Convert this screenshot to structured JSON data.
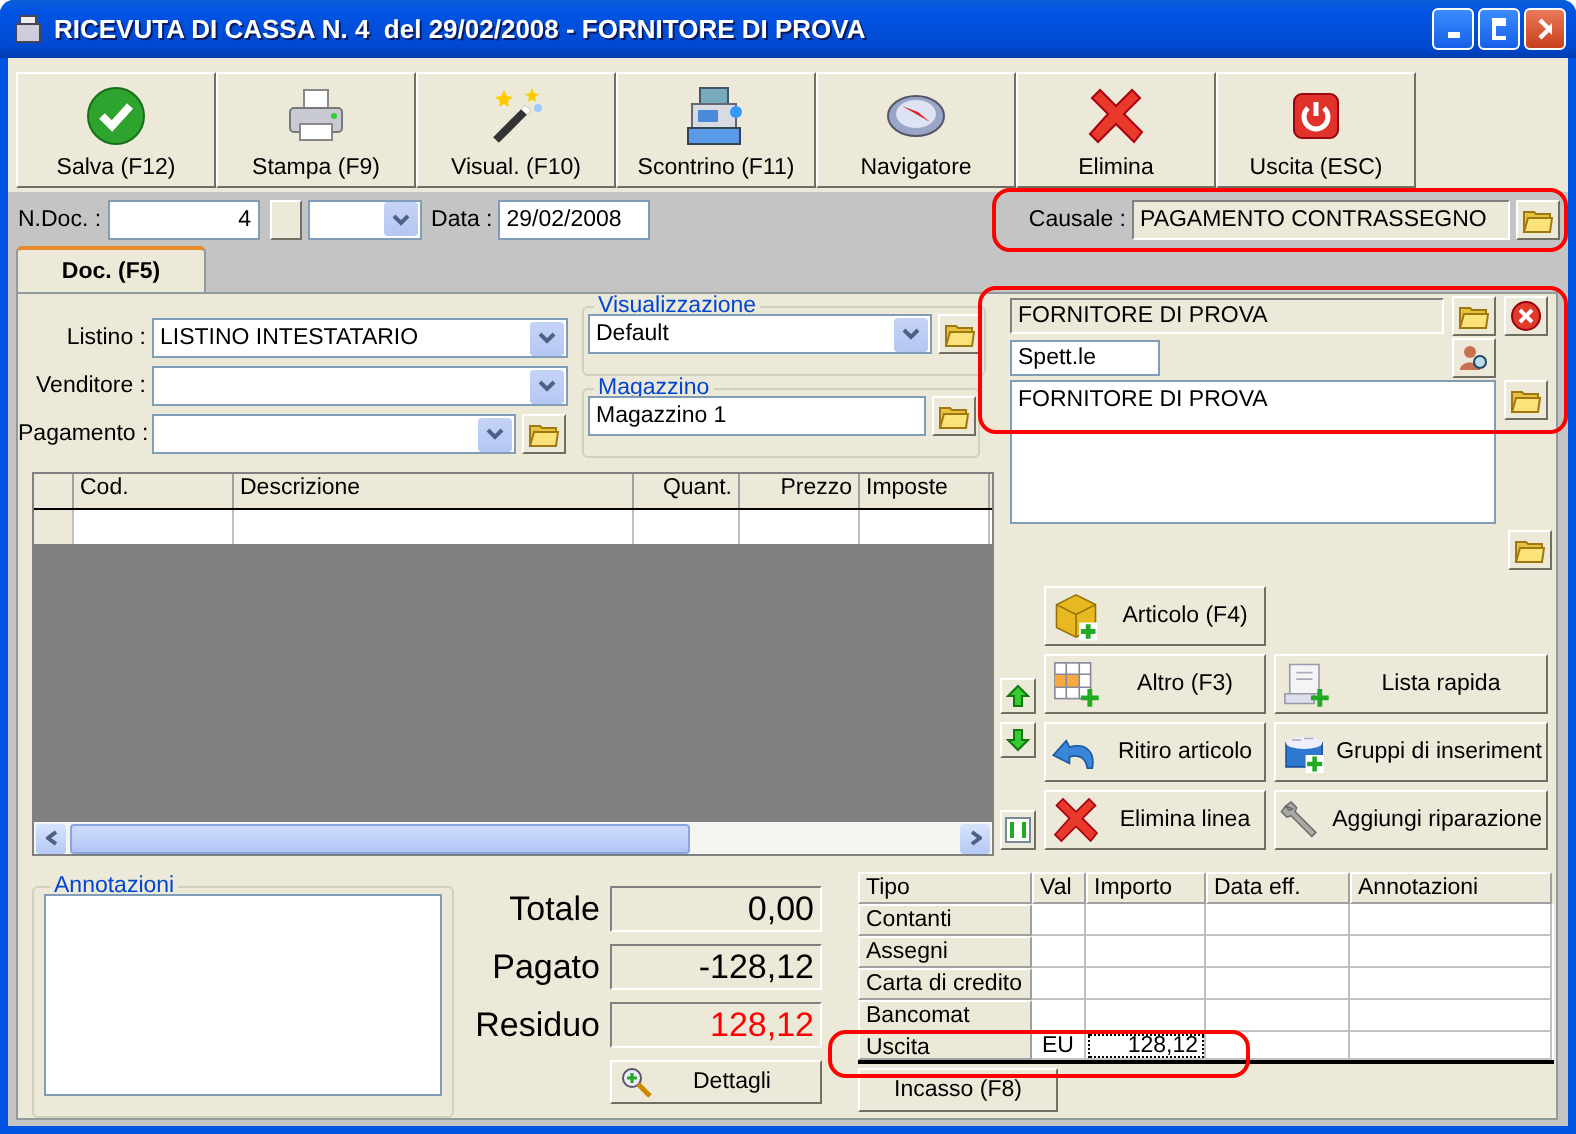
{
  "window": {
    "title": "RICEVUTA DI CASSA N. 4  del 29/02/2008 - FORNITORE DI PROVA"
  },
  "toolbar": [
    {
      "label": "Salva (F12)",
      "kind": "save"
    },
    {
      "label": "Stampa (F9)",
      "kind": "print"
    },
    {
      "label": "Visual. (F10)",
      "kind": "wand"
    },
    {
      "label": "Scontrino (F11)",
      "kind": "register"
    },
    {
      "label": "Navigatore",
      "kind": "compass"
    },
    {
      "label": "Elimina",
      "kind": "delete"
    },
    {
      "label": "Uscita (ESC)",
      "kind": "exit"
    }
  ],
  "header": {
    "ndoc_label": "N.Doc. :",
    "ndoc": "4",
    "date_label": "Data :",
    "date": "29/02/2008",
    "causale_label": "Causale :",
    "causale": "PAGAMENTO CONTRASSEGNO"
  },
  "tabs": [
    {
      "label": "Doc. (F5)",
      "selected": true
    }
  ],
  "form": {
    "fields": [
      {
        "label": "Listino :",
        "value": "LISTINO INTESTATARIO",
        "folder": false
      },
      {
        "label": "Venditore :",
        "folder": false
      },
      {
        "label": "Pagamento :",
        "folder": true
      }
    ],
    "visualizzazione": {
      "title": "Visualizzazione",
      "value": "Default"
    },
    "magazzino": {
      "title": "Magazzino",
      "value": "Magazzino 1"
    }
  },
  "supplier": {
    "name": "FORNITORE DI PROVA",
    "salutation": "Spett.le",
    "address": "FORNITORE DI PROVA"
  },
  "lines_table": {
    "columns": [
      "Cod.",
      "Descrizione",
      "Quant.",
      "Prezzo",
      "Imposte"
    ]
  },
  "actions": [
    {
      "label": "Articolo (F4)",
      "kind": "box"
    },
    {
      "label": "Altro (F3)",
      "kind": "grid"
    },
    {
      "label": "Lista rapida",
      "kind": "scroll"
    },
    {
      "label": "Ritiro articolo",
      "kind": "undo"
    },
    {
      "label": "Gruppi di inseriment",
      "kind": "bucket"
    },
    {
      "label": "Elimina linea",
      "kind": "delete"
    },
    {
      "label": "Aggiungi riparazione",
      "kind": "wrench"
    }
  ],
  "annotations": {
    "title": "Annotazioni"
  },
  "totals": [
    {
      "label": "Totale",
      "value": "0,00",
      "color": "#000000"
    },
    {
      "label": "Pagato",
      "value": "-128,12",
      "color": "#000000"
    },
    {
      "label": "Residuo",
      "value": "128,12",
      "color": "#ff0000"
    }
  ],
  "details_button": "Dettagli",
  "payments": {
    "columns": [
      "Tipo",
      "Val",
      "Importo",
      "Data eff.",
      "Annotazioni"
    ],
    "rows": [
      {
        "tipo": "Contanti",
        "selected": false
      },
      {
        "tipo": "Assegni",
        "selected": false
      },
      {
        "tipo": "Carta di credito",
        "selected": false
      },
      {
        "tipo": "Bancomat",
        "selected": false
      },
      {
        "tipo": "Uscita",
        "val": "EU",
        "importo": "128,12",
        "selected": true
      }
    ]
  },
  "incasso_button": "Incasso (F8)"
}
